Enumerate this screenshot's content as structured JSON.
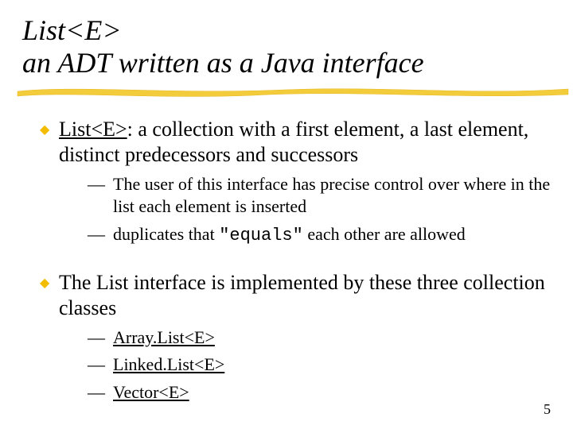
{
  "title_line1": "List<E>",
  "title_line2": " an ADT written as a Java interface",
  "bullets": [
    {
      "lead_underlined": "List<E>",
      "rest": ": a collection with a first element, a last element, distinct predecessors and successors",
      "subs": [
        {
          "pre": "The user of this interface has precise control over where in the list each element is inserted"
        },
        {
          "pre": "duplicates that ",
          "code": "\"equals\"",
          "post": " each other are allowed"
        }
      ]
    },
    {
      "rest": "The List interface is implemented by these three collection classes",
      "subs": [
        {
          "underlined": "Array.List<E>"
        },
        {
          "underlined": "Linked.List<E>"
        },
        {
          "underlined": "Vector<E>"
        }
      ]
    }
  ],
  "page_number": "5"
}
